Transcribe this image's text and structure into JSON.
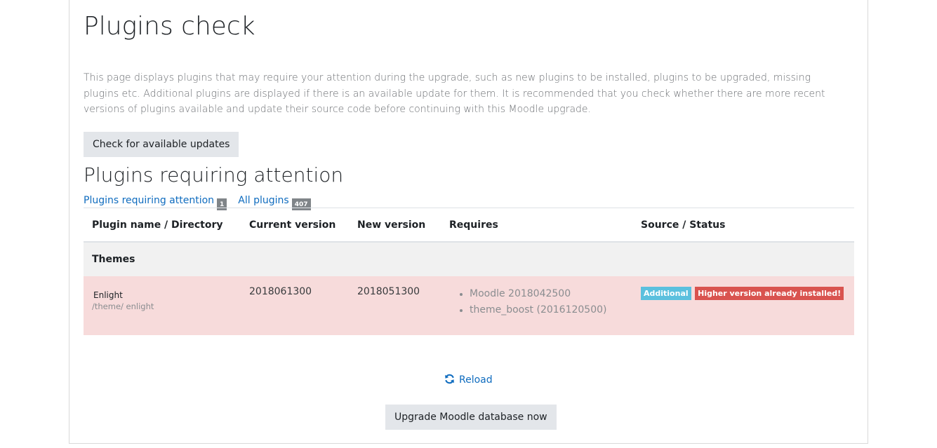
{
  "page": {
    "title": "Plugins check",
    "intro": "This page displays plugins that may require your attention during the upgrade, such as new plugins to be installed, plugins to be upgraded, missing plugins etc. Additional plugins are displayed if there is an available update for them. It is recommended that you check whether there are more recent versions of plugins available and update their source code before continuing with this Moodle upgrade.",
    "check_updates_label": "Check for available updates"
  },
  "section": {
    "title": "Plugins requiring attention",
    "filters": [
      {
        "label": "Plugins requiring attention",
        "count": "1"
      },
      {
        "label": "All plugins",
        "count": "407"
      }
    ]
  },
  "table": {
    "headers": [
      "Plugin name / Directory",
      "Current version",
      "New version",
      "Requires",
      "Source / Status"
    ],
    "group": "Themes",
    "row": {
      "name": "Enlight",
      "directory": "/theme/ enlight",
      "current_version": "2018061300",
      "new_version": "2018051300",
      "requires": [
        "Moodle 2018042500",
        "theme_boost (2016120500)"
      ],
      "source_badge": "Additional",
      "status_badge": "Higher version already installed!"
    }
  },
  "footer": {
    "reload_label": "Reload",
    "upgrade_label": "Upgrade Moodle database now"
  },
  "colors": {
    "link": "#0f6cbf",
    "row_danger_bg": "#f7dbdb",
    "badge_info": "#5bc0de",
    "badge_danger": "#d9534f"
  },
  "icons": {
    "reload": "refresh-icon"
  }
}
